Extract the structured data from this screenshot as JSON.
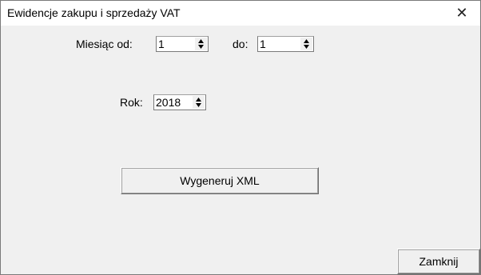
{
  "window": {
    "title": "Ewidencje zakupu i sprzedaży VAT",
    "close_glyph": "✕"
  },
  "form": {
    "month_from_label": "Miesiąc od:",
    "month_from_value": "1",
    "month_to_label": "do:",
    "month_to_value": "1",
    "year_label": "Rok:",
    "year_value": "2018"
  },
  "buttons": {
    "generate_xml": "Wygeneruj XML",
    "close": "Zamknij"
  },
  "icons": {
    "spin_up": "triangle-up-icon",
    "spin_down": "triangle-down-icon"
  }
}
